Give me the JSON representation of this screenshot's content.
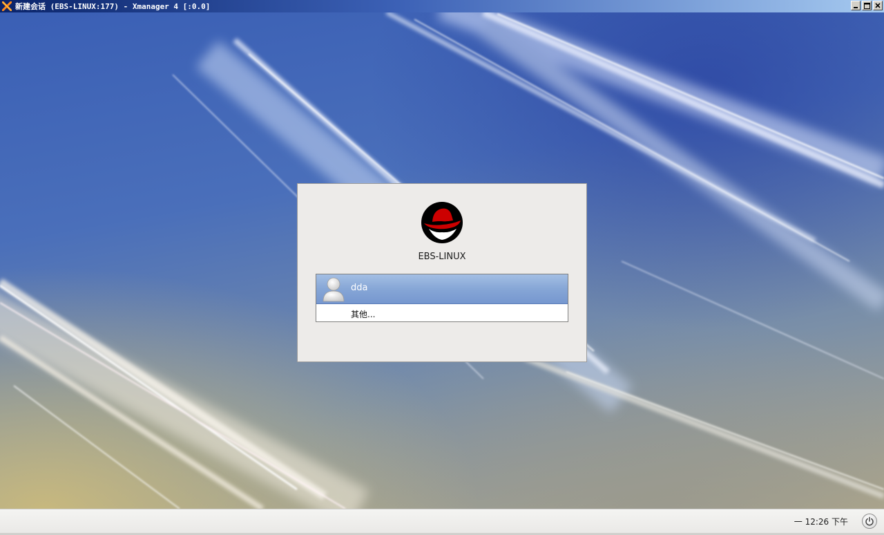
{
  "window": {
    "title": "新建会话 (EBS-LINUX:177) - Xmanager 4 [:0.0]",
    "app_icon": "xmanager-x-icon",
    "controls": {
      "minimize_icon": "minimize-icon",
      "maximize_icon": "maximize-icon",
      "close_icon": "close-icon"
    }
  },
  "login": {
    "logo_icon": "redhat-shadowman-icon",
    "hostname": "EBS-LINUX",
    "users": [
      {
        "name": "dda",
        "avatar_icon": "user-avatar-icon",
        "selected": true
      }
    ],
    "other_label": "其他..."
  },
  "panel": {
    "clock": "一 12:26 下午",
    "power_icon": "power-icon"
  },
  "colors": {
    "titlebar_start": "#0a246a",
    "titlebar_end": "#a6caf0",
    "selection": "#86a6d6",
    "dialog_bg": "#edebe9",
    "logo_red": "#cc0000"
  }
}
